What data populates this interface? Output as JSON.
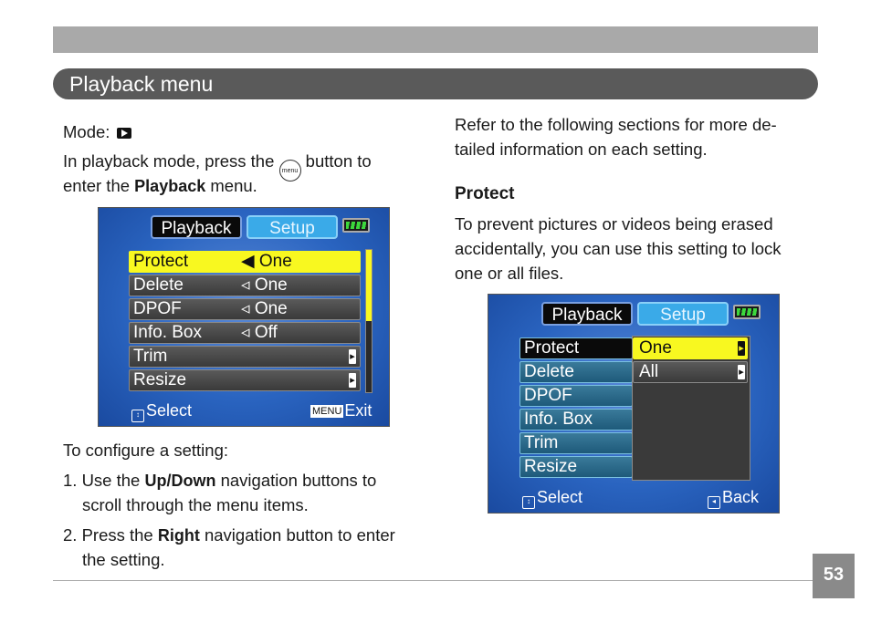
{
  "header": {
    "title": "Playback menu"
  },
  "left": {
    "mode_label": "Mode:",
    "intro_before": "In playback mode, press the",
    "menu_button_text": "menu",
    "intro_after": "button to",
    "intro_line2_before": "enter the",
    "intro_bold": "Playback",
    "intro_line2_after": "menu.",
    "configure_heading": "To configure a setting:",
    "step1_before": "1. Use the",
    "step1_bold": "Up/Down",
    "step1_after": "navigation buttons to",
    "step1_line2": "scroll through the menu items.",
    "step2_before": "2. Press the",
    "step2_bold": "Right",
    "step2_after": "navigation button to enter",
    "step2_line2": "the setting."
  },
  "right": {
    "refer_line1": "Refer to the following sections for more de-",
    "refer_line2": "tailed information on each setting.",
    "protect_heading": "Protect",
    "protect_line1": "To prevent pictures or videos being erased",
    "protect_line2": "accidentally, you can use this setting to lock",
    "protect_line3": "one or all files."
  },
  "screen1": {
    "tab_playback": "Playback",
    "tab_setup": "Setup",
    "rows": [
      {
        "label": "Protect",
        "value": "One"
      },
      {
        "label": "Delete",
        "value": "One"
      },
      {
        "label": "DPOF",
        "value": "One"
      },
      {
        "label": "Info. Box",
        "value": "Off"
      },
      {
        "label": "Trim",
        "value": ""
      },
      {
        "label": "Resize",
        "value": ""
      }
    ],
    "footer_select": "Select",
    "footer_menu_key": "MENU",
    "footer_exit": "Exit"
  },
  "screen2": {
    "tab_playback": "Playback",
    "tab_setup": "Setup",
    "rows": [
      "Protect",
      "Delete",
      "DPOF",
      "Info. Box",
      "Trim",
      "Resize"
    ],
    "options": [
      "One",
      "All"
    ],
    "footer_select": "Select",
    "footer_back": "Back"
  },
  "page": {
    "number": "53"
  },
  "colors": {
    "highlight": "#f8f820",
    "header_bg": "#5a5a5a",
    "screen_blue": "#2a64c0"
  }
}
